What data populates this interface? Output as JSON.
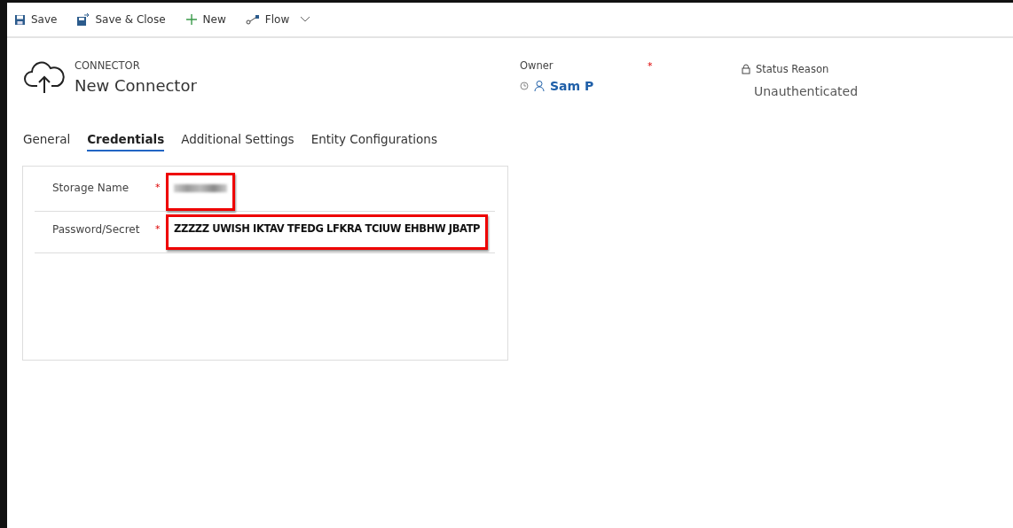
{
  "toolbar": [
    {
      "kind": "save",
      "label": "Save"
    },
    {
      "kind": "save-close",
      "label": "Save & Close"
    },
    {
      "kind": "new",
      "label": "New"
    },
    {
      "kind": "flow",
      "label": "Flow"
    }
  ],
  "header": {
    "entity": "CONNECTOR",
    "title": "New Connector",
    "owner": {
      "label": "Owner",
      "required_mark": "*",
      "value": "Sam P"
    },
    "status": {
      "label": "Status Reason",
      "value": "Unauthenticated"
    }
  },
  "tabs": [
    {
      "label": "General",
      "selected": false
    },
    {
      "label": "Credentials",
      "selected": true
    },
    {
      "label": "Additional Settings",
      "selected": false
    },
    {
      "label": "Entity Configurations",
      "selected": false
    }
  ],
  "fields": [
    {
      "label": "Storage Name",
      "required_mark": "*",
      "redacted": true,
      "highlighted": true
    },
    {
      "label": "Password/Secret",
      "required_mark": "*",
      "value": "ZZZZZ UWISH IKTAV TFEDG LFKRA TCIUW EHBHW JBATP",
      "redacted": false,
      "highlighted": true
    }
  ]
}
